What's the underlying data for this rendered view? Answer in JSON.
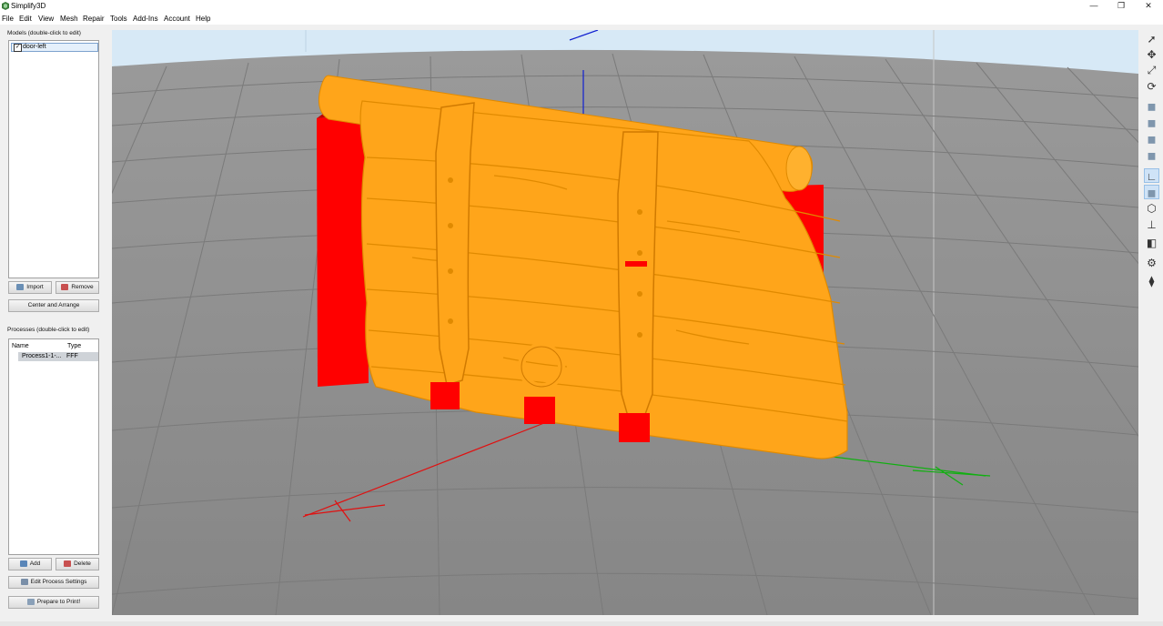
{
  "app": {
    "title": "Simplify3D"
  },
  "window_controls": {
    "minimize": "—",
    "maximize": "❐",
    "close": "✕"
  },
  "menu": [
    "File",
    "Edit",
    "View",
    "Mesh",
    "Repair",
    "Tools",
    "Add-Ins",
    "Account",
    "Help"
  ],
  "models_panel": {
    "label": "Models (double-click to edit)",
    "items": [
      {
        "name": "door-left",
        "checked": true
      }
    ],
    "import_label": "Import",
    "remove_label": "Remove",
    "center_label": "Center and Arrange"
  },
  "processes_panel": {
    "label": "Processes (double-click to edit)",
    "columns": [
      "Name",
      "Type"
    ],
    "rows": [
      {
        "name": "Process1-1-...",
        "type": "FFF"
      }
    ],
    "add_label": "Add",
    "delete_label": "Delete",
    "edit_label": "Edit Process Settings",
    "prepare_label": "Prepare to Print!"
  },
  "right_toolbar": [
    "select-icon",
    "move-icon",
    "scale-icon",
    "rotate-icon",
    "view-top-icon",
    "view-front-icon",
    "view-side-icon",
    "view-iso-icon",
    "axes-icon",
    "solid-view-icon",
    "wireframe-icon",
    "axis-toggle-icon",
    "cross-section-icon",
    "settings-gear-icon",
    "support-icon"
  ],
  "colors": {
    "model": "#ffa51a",
    "model_shadow": "#e08a00",
    "support": "#ff0000",
    "bed": "#8f8f8f",
    "sky": "#d7e9f6",
    "x_axis": "#e01010",
    "y_axis": "#10b010",
    "z_axis": "#1020d0"
  }
}
